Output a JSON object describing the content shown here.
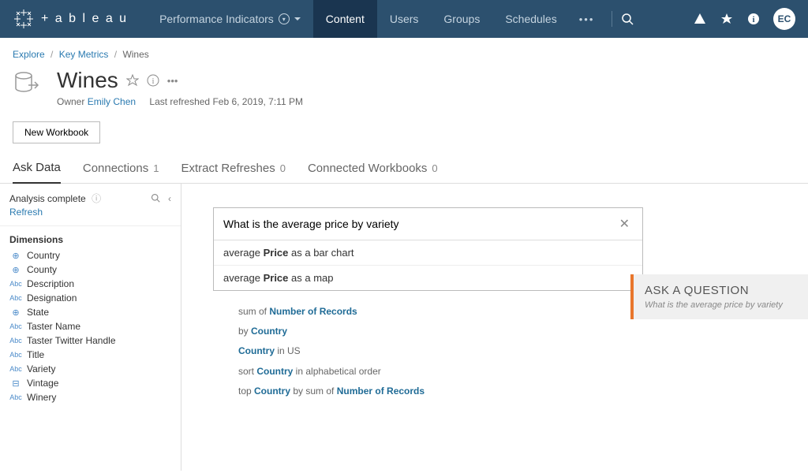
{
  "topbar": {
    "logo_text": "+ a b l e a u",
    "nav": {
      "performance": "Performance Indicators",
      "content": "Content",
      "users": "Users",
      "groups": "Groups",
      "schedules": "Schedules"
    },
    "avatar": "EC"
  },
  "breadcrumb": {
    "explore": "Explore",
    "key_metrics": "Key Metrics",
    "current": "Wines"
  },
  "header": {
    "title": "Wines",
    "owner_label": "Owner",
    "owner_name": "Emily Chen",
    "refreshed_label": "Last refreshed",
    "refreshed_value": "Feb 6, 2019, 7:11 PM"
  },
  "actions": {
    "new_workbook": "New Workbook"
  },
  "tabs": {
    "ask_data": "Ask Data",
    "connections": "Connections",
    "connections_count": "1",
    "extract": "Extract Refreshes",
    "extract_count": "0",
    "connected": "Connected Workbooks",
    "connected_count": "0"
  },
  "sidebar": {
    "status": "Analysis complete",
    "refresh": "Refresh",
    "dimensions_title": "Dimensions",
    "fields": [
      {
        "icon": "globe",
        "label": "Country"
      },
      {
        "icon": "globe",
        "label": "County"
      },
      {
        "icon": "abc",
        "label": "Description"
      },
      {
        "icon": "abc",
        "label": "Designation"
      },
      {
        "icon": "globe",
        "label": "State"
      },
      {
        "icon": "abc",
        "label": "Taster Name"
      },
      {
        "icon": "abc",
        "label": "Taster Twitter Handle"
      },
      {
        "icon": "abc",
        "label": "Title"
      },
      {
        "icon": "abc",
        "label": "Variety"
      },
      {
        "icon": "date",
        "label": "Vintage"
      },
      {
        "icon": "abc",
        "label": "Winery"
      }
    ]
  },
  "ask": {
    "query": "What is the average price by variety",
    "suggestions": [
      {
        "pre": "average ",
        "bold": "Price",
        "post": " as a bar chart"
      },
      {
        "pre": "average ",
        "bold": "Price",
        "post": " as a map"
      }
    ],
    "more": [
      {
        "parts": [
          {
            "t": "plain",
            "v": "sum of "
          },
          {
            "t": "fld",
            "v": "Number of Records"
          }
        ]
      },
      {
        "parts": [
          {
            "t": "plain",
            "v": "by "
          },
          {
            "t": "fld",
            "v": "Country"
          }
        ]
      },
      {
        "parts": [
          {
            "t": "fld",
            "v": "Country"
          },
          {
            "t": "plain",
            "v": " in US"
          }
        ]
      },
      {
        "parts": [
          {
            "t": "plain",
            "v": "sort "
          },
          {
            "t": "fld",
            "v": "Country"
          },
          {
            "t": "plain",
            "v": " in alphabetical order"
          }
        ]
      },
      {
        "parts": [
          {
            "t": "plain",
            "v": "top "
          },
          {
            "t": "fld",
            "v": "Country"
          },
          {
            "t": "plain",
            "v": " by sum of "
          },
          {
            "t": "fld",
            "v": "Number of Records"
          }
        ]
      }
    ]
  },
  "callout": {
    "title": "ASK A QUESTION",
    "sub": "What is the average price by variety"
  }
}
